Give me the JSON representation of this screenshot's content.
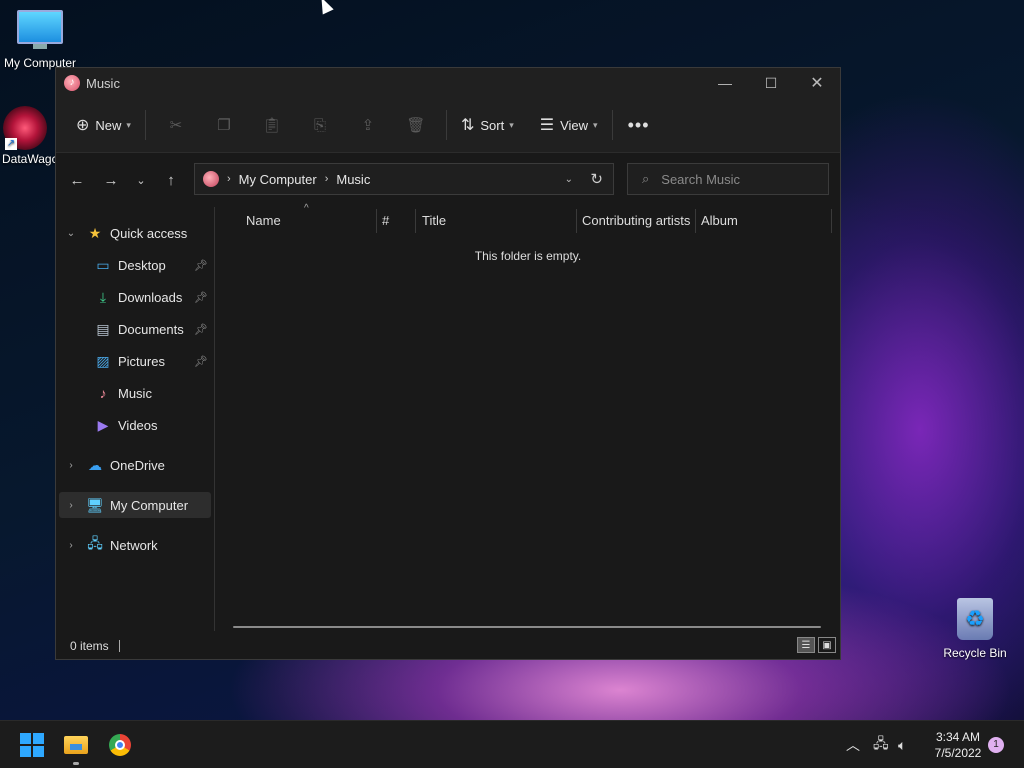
{
  "desktop": {
    "icons": [
      {
        "label": "My Computer",
        "icon": "monitor-icon"
      },
      {
        "label": "DataWagc",
        "icon": "datawagon-icon"
      },
      {
        "label": "Recycle Bin",
        "icon": "recycle-bin-icon"
      }
    ]
  },
  "window": {
    "title": "Music",
    "toolbar": {
      "new_label": "New",
      "sort_label": "Sort",
      "view_label": "View"
    },
    "address": {
      "crumbs": [
        "My Computer",
        "Music"
      ]
    },
    "search": {
      "placeholder": "Search Music"
    },
    "sidebar": {
      "quick_access": "Quick access",
      "items": [
        {
          "label": "Desktop",
          "icon": "desktop-icon"
        },
        {
          "label": "Downloads",
          "icon": "downloads-icon"
        },
        {
          "label": "Documents",
          "icon": "documents-icon"
        },
        {
          "label": "Pictures",
          "icon": "pictures-icon"
        },
        {
          "label": "Music",
          "icon": "music-icon"
        },
        {
          "label": "Videos",
          "icon": "videos-icon"
        }
      ],
      "onedrive": "OneDrive",
      "my_computer": "My Computer",
      "network": "Network"
    },
    "columns": [
      "Name",
      "#",
      "Title",
      "Contributing artists",
      "Album"
    ],
    "empty_message": "This folder is empty.",
    "status": {
      "count": "0 items"
    }
  },
  "taskbar": {
    "time": "3:34 AM",
    "date": "7/5/2022",
    "notification_count": "1"
  }
}
